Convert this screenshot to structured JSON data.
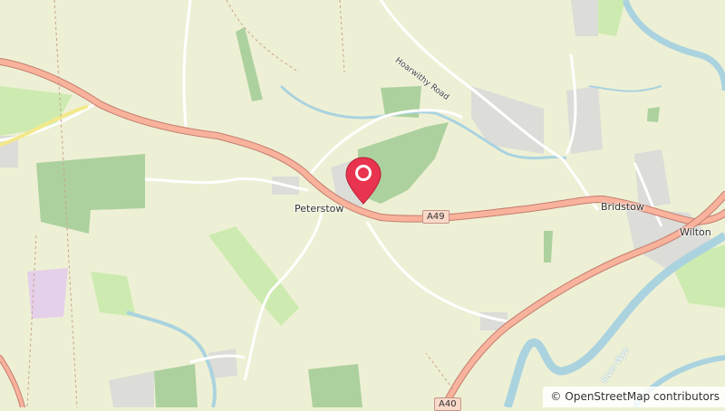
{
  "map": {
    "places": {
      "peterstow": "Peterstow",
      "bridstow": "Bridstow",
      "wilton": "Wilton"
    },
    "roads": {
      "a49": "A49",
      "a40": "A40",
      "hoarwithy_road": "Hoarwithy Road"
    },
    "water": {
      "river_wye": "River Wye"
    },
    "colors": {
      "land": "#eef0d5",
      "woodland": "#add19e",
      "grass": "#cdebb0",
      "residential": "#e0dfdf",
      "trunk_road": "#f9b29c",
      "water": "#aad3df",
      "marker": "#e8344e"
    }
  },
  "marker": {
    "icon": "map-pin-icon"
  },
  "attribution": {
    "symbol": "©",
    "text": "OpenStreetMap contributors"
  }
}
